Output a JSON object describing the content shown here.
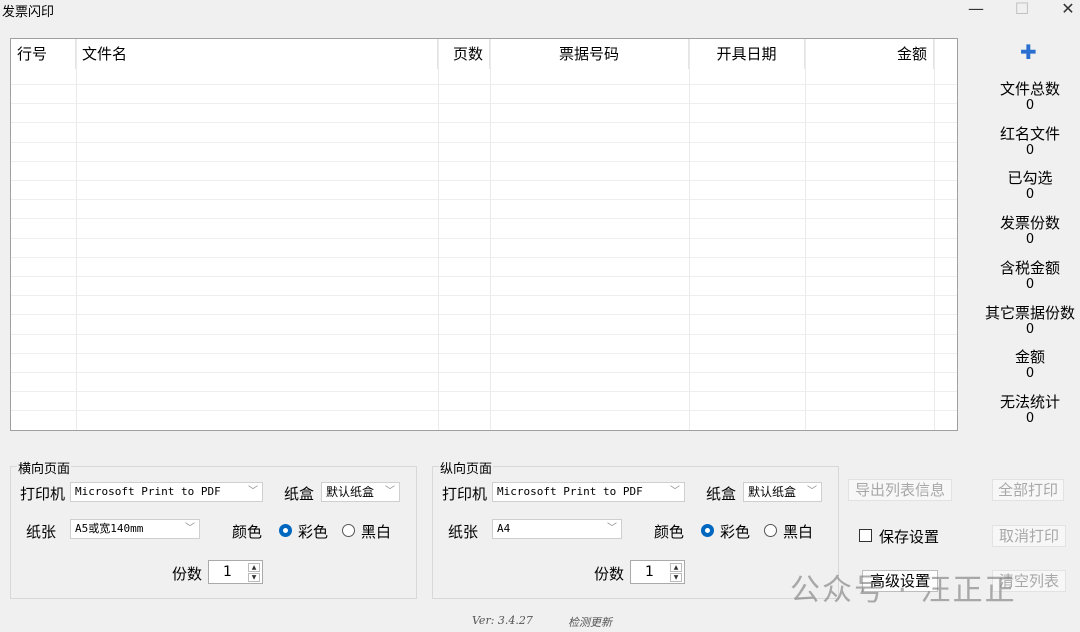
{
  "window": {
    "title": "发票闪印",
    "minimize": "—",
    "maximize": "☐",
    "close": "✕"
  },
  "table": {
    "columns": [
      "行号",
      "文件名",
      "页数",
      "票据号码",
      "开具日期",
      "金额"
    ],
    "rows": []
  },
  "sidebar": {
    "add_icon": "plus-icon",
    "stats": [
      {
        "label": "文件总数",
        "value": "0"
      },
      {
        "label": "红名文件",
        "value": "0"
      },
      {
        "label": "已勾选",
        "value": "0"
      },
      {
        "label": "发票份数",
        "value": "0"
      },
      {
        "label": "含税金额",
        "value": "0"
      },
      {
        "label": "其它票据份数",
        "value": "0"
      },
      {
        "label": "金额",
        "value": "0"
      },
      {
        "label": "无法统计",
        "value": "0"
      }
    ]
  },
  "landscape": {
    "title": "横向页面",
    "printer_label": "打印机",
    "printer": "Microsoft Print to PDF",
    "tray_label": "纸盒",
    "tray": "默认纸盒",
    "paper_label": "纸张",
    "paper": "A5或宽140mm",
    "color_label": "颜色",
    "color_opt": "彩色",
    "bw_opt": "黑白",
    "copies_label": "份数",
    "copies": "1"
  },
  "portrait": {
    "title": "纵向页面",
    "printer_label": "打印机",
    "printer": "Microsoft Print to PDF",
    "tray_label": "纸盒",
    "tray": "默认纸盒",
    "paper_label": "纸张",
    "paper": "A4",
    "color_label": "颜色",
    "color_opt": "彩色",
    "bw_opt": "黑白",
    "copies_label": "份数",
    "copies": "1"
  },
  "actions": {
    "export": "导出列表信息",
    "print_all": "全部打印",
    "save_settings": "保存设置",
    "cancel_print": "取消打印",
    "advanced": "高级设置",
    "clear_list": "清空列表"
  },
  "footer": {
    "version": "Ver: 3.4.27",
    "check_update": "检测更新"
  },
  "watermark": "公众号 · 汪正正",
  "colors": {
    "accent": "#0067c0"
  }
}
